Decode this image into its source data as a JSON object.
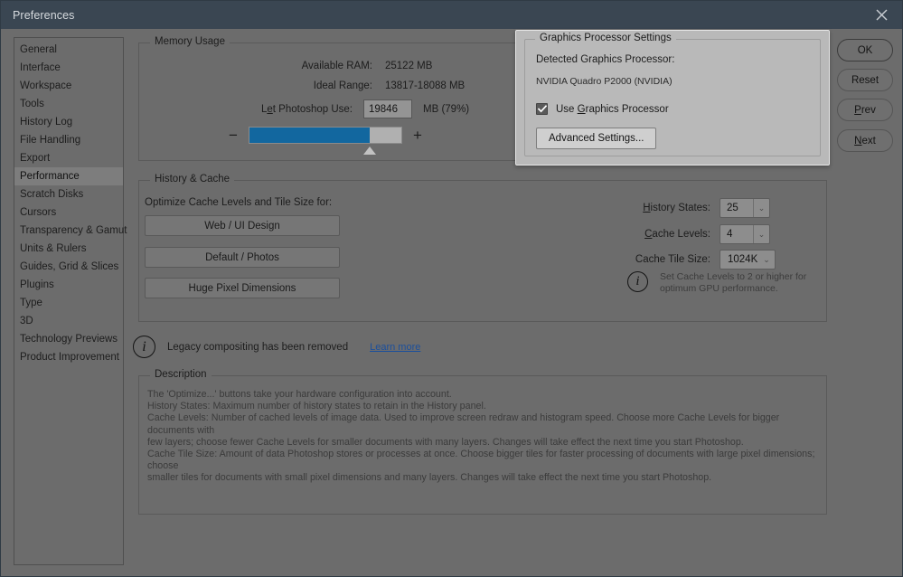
{
  "window": {
    "title": "Preferences",
    "close_icon": "close-icon"
  },
  "sidebar": {
    "items": [
      {
        "label": "General",
        "selected": false
      },
      {
        "label": "Interface",
        "selected": false
      },
      {
        "label": "Workspace",
        "selected": false
      },
      {
        "label": "Tools",
        "selected": false
      },
      {
        "label": "History Log",
        "selected": false
      },
      {
        "label": "File Handling",
        "selected": false
      },
      {
        "label": "Export",
        "selected": false
      },
      {
        "label": "Performance",
        "selected": true
      },
      {
        "label": "Scratch Disks",
        "selected": false
      },
      {
        "label": "Cursors",
        "selected": false
      },
      {
        "label": "Transparency & Gamut",
        "selected": false
      },
      {
        "label": "Units & Rulers",
        "selected": false
      },
      {
        "label": "Guides, Grid & Slices",
        "selected": false
      },
      {
        "label": "Plugins",
        "selected": false
      },
      {
        "label": "Type",
        "selected": false
      },
      {
        "label": "3D",
        "selected": false
      },
      {
        "label": "Technology Previews",
        "selected": false
      },
      {
        "label": "Product Improvement",
        "selected": false
      }
    ]
  },
  "memory_usage": {
    "legend": "Memory Usage",
    "available_ram_label": "Available RAM:",
    "available_ram_value": "25122 MB",
    "ideal_range_label": "Ideal Range:",
    "ideal_range_value": "13817-18088 MB",
    "let_photoshop_use_label_pre": "L",
    "let_photoshop_use_label_key": "e",
    "let_photoshop_use_label_post": "t Photoshop Use:",
    "let_photoshop_use_value": "19846",
    "units_percent": "MB (79%)",
    "slider_percent": 79,
    "minus_label": "−",
    "plus_label": "+"
  },
  "graphics_processor": {
    "legend": "Graphics Processor Settings",
    "detected_label": "Detected Graphics Processor:",
    "detected_value": "NVIDIA Quadro P2000 (NVIDIA)",
    "use_gpu_pre": "Use ",
    "use_gpu_key": "G",
    "use_gpu_post": "raphics Processor",
    "use_gpu_checked": true,
    "advanced_button": "Advanced Settings..."
  },
  "history_cache": {
    "legend": "History & Cache",
    "optimize_label": "Optimize Cache Levels and Tile Size for:",
    "buttons": [
      "Web / UI Design",
      "Default / Photos",
      "Huge Pixel Dimensions"
    ],
    "history_states_pre": "H",
    "history_states_post": "istory States:",
    "history_states_value": "25",
    "cache_levels_pre": "C",
    "cache_levels_post": "ache Levels:",
    "cache_levels_value": "4",
    "cache_tile_label": "Cache Tile Size:",
    "cache_tile_value": "1024K",
    "gpu_note": "Set Cache Levels to 2 or higher for\noptimum GPU performance.",
    "info_glyph": "i",
    "caret_glyph": "⌄"
  },
  "legacy_notice": {
    "text": "Legacy compositing has been removed",
    "link": "Learn more",
    "info_glyph": "i"
  },
  "description": {
    "legend": "Description",
    "body": "The 'Optimize...' buttons take your hardware configuration into account.\nHistory States: Maximum number of history states to retain in the History panel.\nCache Levels: Number of cached levels of image data.  Used to improve screen redraw and histogram speed.  Choose more Cache Levels for bigger documents with\nfew layers; choose fewer Cache Levels for smaller documents with many layers. Changes will take effect the next time you start Photoshop.\nCache Tile Size: Amount of data Photoshop stores or processes at once. Choose bigger tiles for faster processing of documents with large pixel dimensions; choose\nsmaller tiles for documents with small pixel dimensions and many layers. Changes will take effect the next time you start Photoshop."
  },
  "actions": {
    "ok": "OK",
    "reset": "Reset",
    "prev_pre": "P",
    "prev_post": "rev",
    "next_pre": "N",
    "next_post": "ext"
  },
  "colors": {
    "dialog_bg": "#6c6c6c",
    "titlebar_bg": "#3a4652",
    "accent_blue": "#12679f",
    "link_blue": "#1b4f9c",
    "overlay_bg": "#b9b9b9",
    "selected_item_bg": "#7d7d7d"
  }
}
